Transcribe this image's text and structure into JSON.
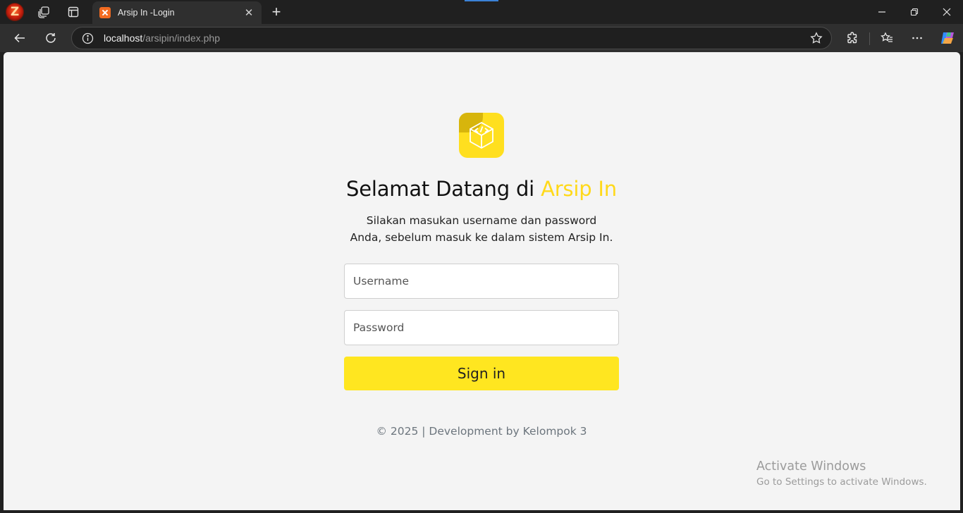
{
  "browser": {
    "tab_title": "Arsip In -Login",
    "url_host": "localhost",
    "url_path": "/arsipin/index.php"
  },
  "login": {
    "heading_prefix": "Selamat Datang di ",
    "heading_brand": "Arsip In",
    "subtitle_line1": "Silakan masukan username dan password",
    "subtitle_line2": "Anda, sebelum masuk ke dalam sistem Arsip In.",
    "username_placeholder": "Username",
    "password_placeholder": "Password",
    "signin_label": "Sign in",
    "brand_color": "#ffdf1f"
  },
  "footer": {
    "text": "© 2025 | Development by Kelompok 3"
  },
  "watermark": {
    "title": "Activate Windows",
    "subtitle": "Go to Settings to activate Windows."
  },
  "icons": [
    "app-logo-icon",
    "workspaces-icon",
    "tab-actions-icon",
    "xampp-favicon-icon",
    "close-icon",
    "plus-icon",
    "minimize-icon",
    "restore-icon",
    "window-close-icon",
    "back-icon",
    "refresh-icon",
    "site-info-icon",
    "star-icon",
    "extensions-icon",
    "favorites-icon",
    "more-icon",
    "copilot-icon",
    "arsip-logo-icon"
  ]
}
